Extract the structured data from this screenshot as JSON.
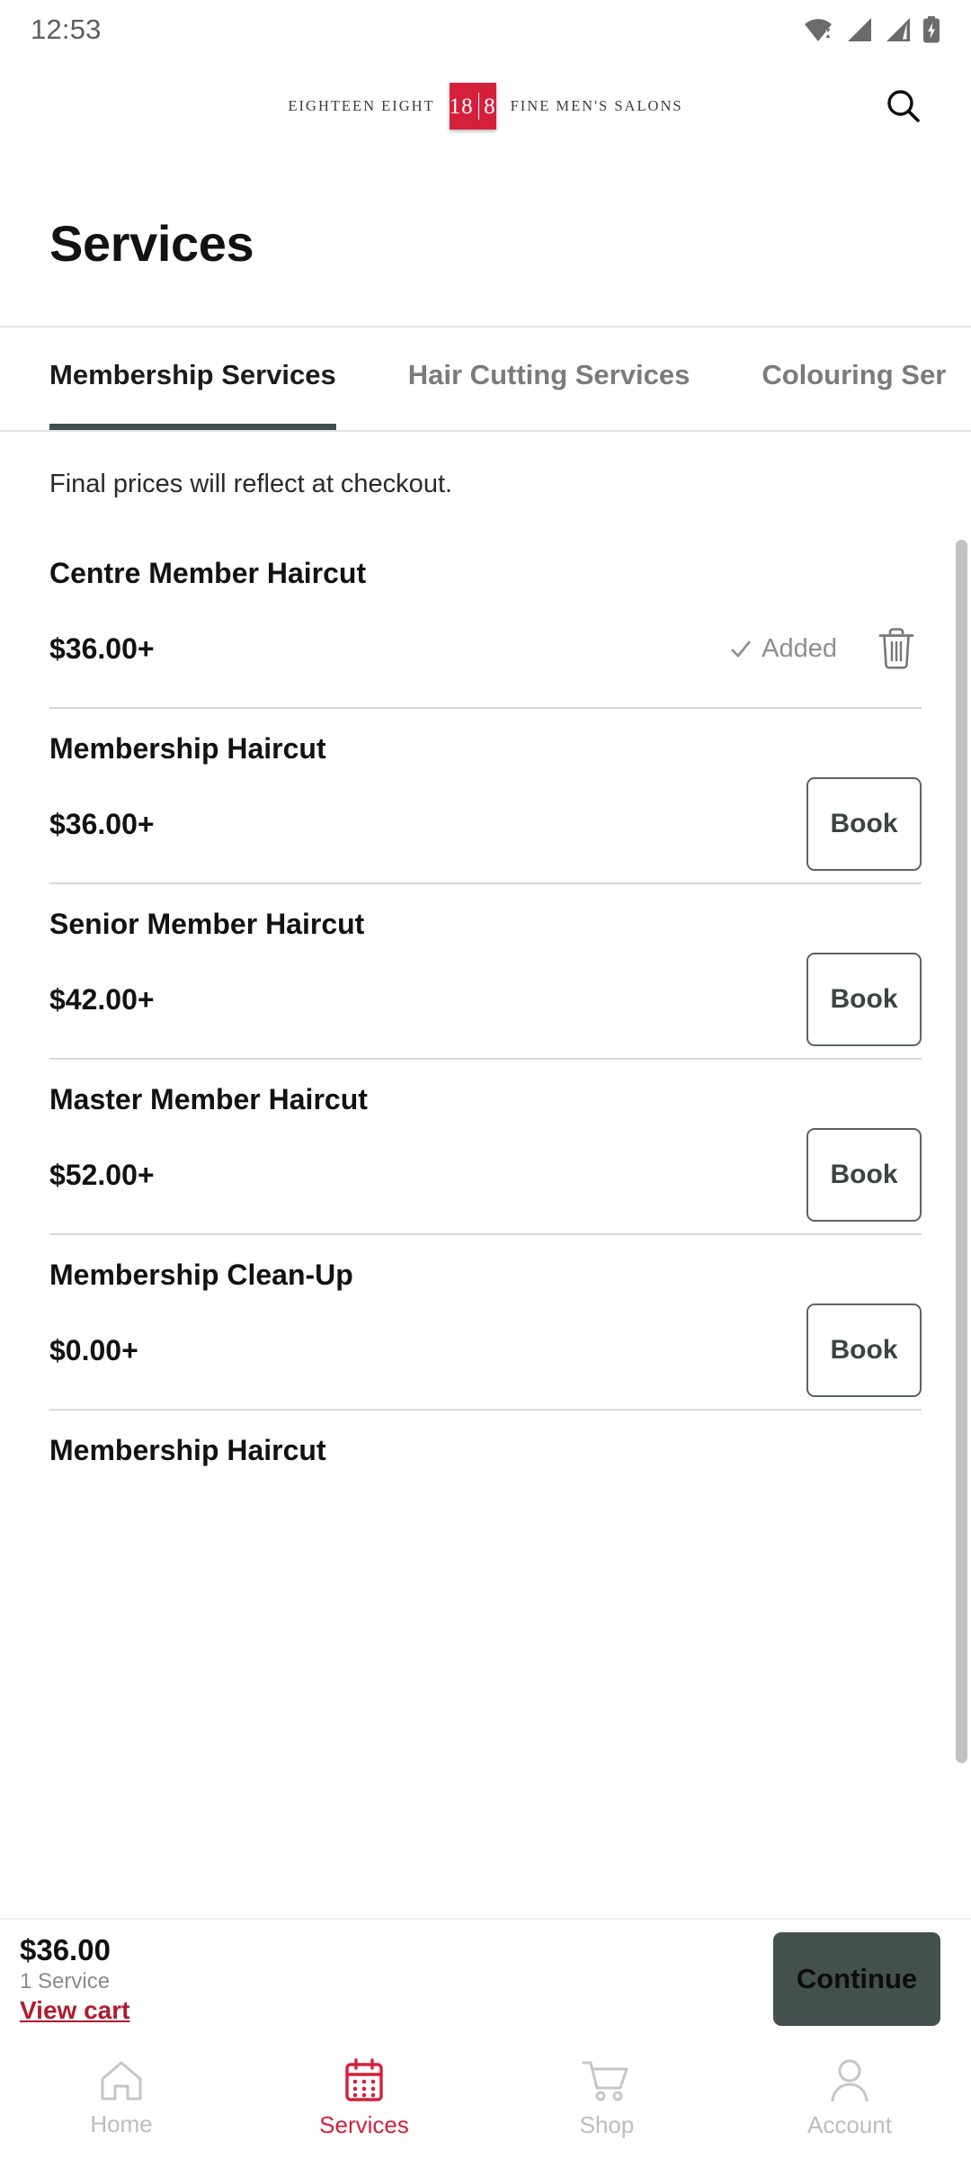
{
  "status_bar": {
    "time": "12:53",
    "icons": [
      "wifi-icon",
      "signal-icon",
      "signal-icon",
      "battery-charging-icon"
    ]
  },
  "header": {
    "logo_left": "EIGHTEEN EIGHT",
    "logo_mark_left": "18",
    "logo_mark_right": "8",
    "logo_right": "FINE MEN'S SALONS",
    "search_icon": "search-icon",
    "brand_red": "#d5203c"
  },
  "page": {
    "title": "Services",
    "notice": "Final prices will reflect at checkout."
  },
  "tabs": [
    {
      "label": "Membership Services",
      "active": true
    },
    {
      "label": "Hair Cutting Services",
      "active": false
    },
    {
      "label": "Colouring Ser",
      "active": false
    }
  ],
  "services": [
    {
      "name": "Centre Member Haircut",
      "price": "$36.00+",
      "state": "added",
      "added_label": "Added",
      "check_icon": "check-icon",
      "delete_icon": "trash-icon"
    },
    {
      "name": "Membership Haircut",
      "price": "$36.00+",
      "state": "book",
      "book_label": "Book"
    },
    {
      "name": "Senior Member Haircut",
      "price": "$42.00+",
      "state": "book",
      "book_label": "Book"
    },
    {
      "name": "Master Member Haircut",
      "price": "$52.00+",
      "state": "book",
      "book_label": "Book"
    },
    {
      "name": "Membership Clean-Up",
      "price": "$0.00+",
      "state": "book",
      "book_label": "Book"
    },
    {
      "name": "Membership Haircut",
      "price": "",
      "state": "partial"
    }
  ],
  "cart": {
    "total": "$36.00",
    "count": "1 Service",
    "view_cart_label": "View cart",
    "continue_label": "Continue",
    "link_color": "#b01c2e",
    "continue_bg": "#44504e"
  },
  "bottom_nav": [
    {
      "label": "Home",
      "icon": "home-icon",
      "active": false
    },
    {
      "label": "Services",
      "icon": "calendar-icon",
      "active": true
    },
    {
      "label": "Shop",
      "icon": "cart-icon",
      "active": false
    },
    {
      "label": "Account",
      "icon": "person-icon",
      "active": false
    }
  ]
}
